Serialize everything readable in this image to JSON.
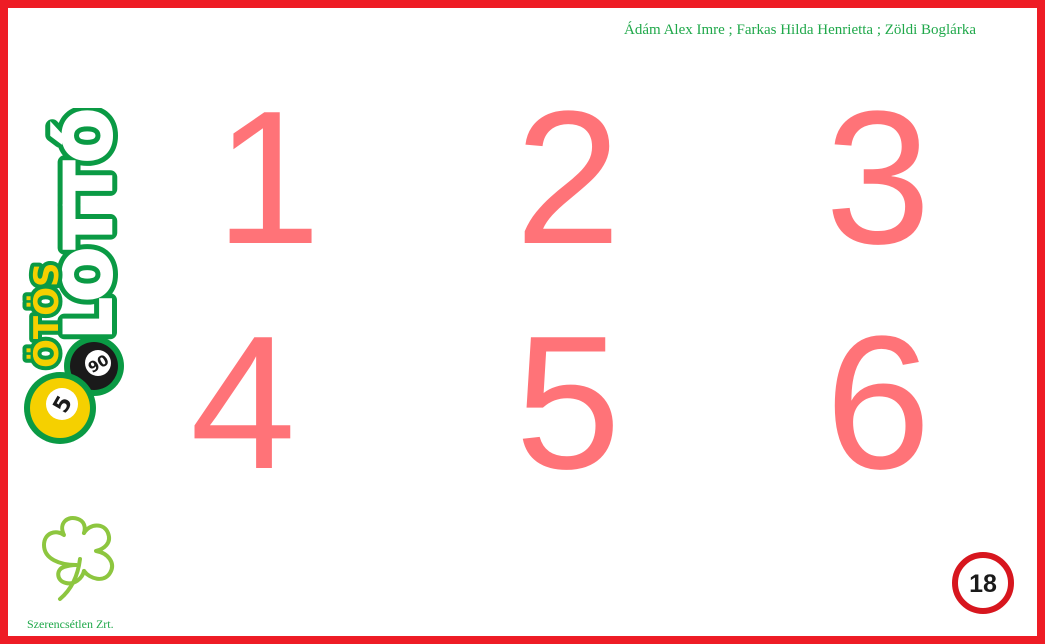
{
  "header": {
    "authors": "Ádám Alex Imre ; Farkas Hilda Henrietta ; Zöldi Boglárka"
  },
  "logo": {
    "top_text": "ÖTÖS",
    "main_text": "LOTTÓ",
    "ball_big": "5",
    "ball_small": "90",
    "colors": {
      "green": "#0a9a44",
      "yellow": "#f5d000",
      "black": "#1a1a1a"
    }
  },
  "numbers": {
    "n1": "1",
    "n2": "2",
    "n3": "3",
    "n4": "4",
    "n5": "5",
    "n6": "6"
  },
  "footer": {
    "company": "Szerencsétlen Zrt.",
    "age_badge": "18"
  },
  "colors": {
    "frame": "#ee1c25",
    "number": "#ff7378",
    "text_green": "#1fa84a",
    "clover": "#8dc63f"
  }
}
